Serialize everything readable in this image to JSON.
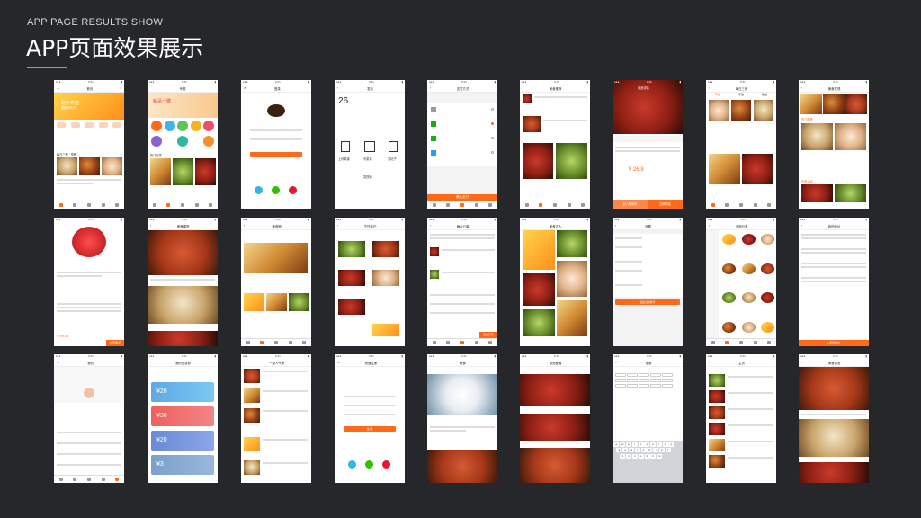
{
  "header": {
    "subtitle": "APP PAGE RESULTS SHOW",
    "title": "APP页面效果展示"
  },
  "colors": {
    "accent": "#ff6a1a",
    "background": "#26272b"
  },
  "screens": {
    "s1": {
      "nav": "首页",
      "banner1": "助手烘焙",
      "banner2": "翻新好时光",
      "section": "每日三餐 · 早餐"
    },
    "s2": {
      "nav": "专题",
      "banner": "新品一键",
      "section": "热门分类"
    },
    "s3": {
      "nav": "登录"
    },
    "s4": {
      "nav": "发布",
      "day": "26",
      "label1": "上传菜谱",
      "label2": "写菜谱",
      "label3": "发帖子",
      "label4": "发视频"
    },
    "s5": {
      "nav": "支付方式",
      "pay": "确认支付"
    },
    "s6": {
      "nav": "美食推荐"
    },
    "s7": {
      "nav": "商品详情",
      "price": "¥ 26.8",
      "btn1": "加入购物车",
      "btn2": "立即购买"
    },
    "s8": {
      "nav": "每日三餐",
      "tab1": "早餐",
      "tab2": "午餐",
      "tab3": "晚餐"
    },
    "s9": {
      "nav": "美食发现",
      "sec1": "热门推荐",
      "sec2": "优惠活动"
    },
    "s10": {
      "price": "¥ 99.00",
      "btn": "立即购买"
    },
    "s11": {
      "nav": "美食课堂"
    },
    "s12": {
      "nav": "美食圈"
    },
    "s13": {
      "nav": "烹饪技巧"
    },
    "s14": {
      "nav": "确认订单",
      "btn": "提交订单"
    },
    "s15": {
      "nav": "美食达人"
    },
    "s16": {
      "nav": "设置",
      "btn": "退出当前账号"
    },
    "s17": {
      "nav": "全部分类"
    },
    "s18": {
      "nav": "我的地址",
      "btn": "+ 新增地址"
    },
    "s19": {
      "nav": "我的"
    },
    "s20": {
      "nav": "我的优惠券",
      "c1": "¥20",
      "c2": "¥30",
      "c3": "¥20",
      "c4": "¥3"
    },
    "s21": {
      "nav": "一周人气榜"
    },
    "s22": {
      "nav": "快速注册",
      "btn": "注 册"
    },
    "s23": {
      "nav": "美食"
    },
    "s24": {
      "nav": "甜品食谱"
    },
    "s25": {
      "nav": "搜索"
    },
    "s26": {
      "nav": "主页"
    },
    "s27": {
      "nav": "美食课堂"
    }
  }
}
